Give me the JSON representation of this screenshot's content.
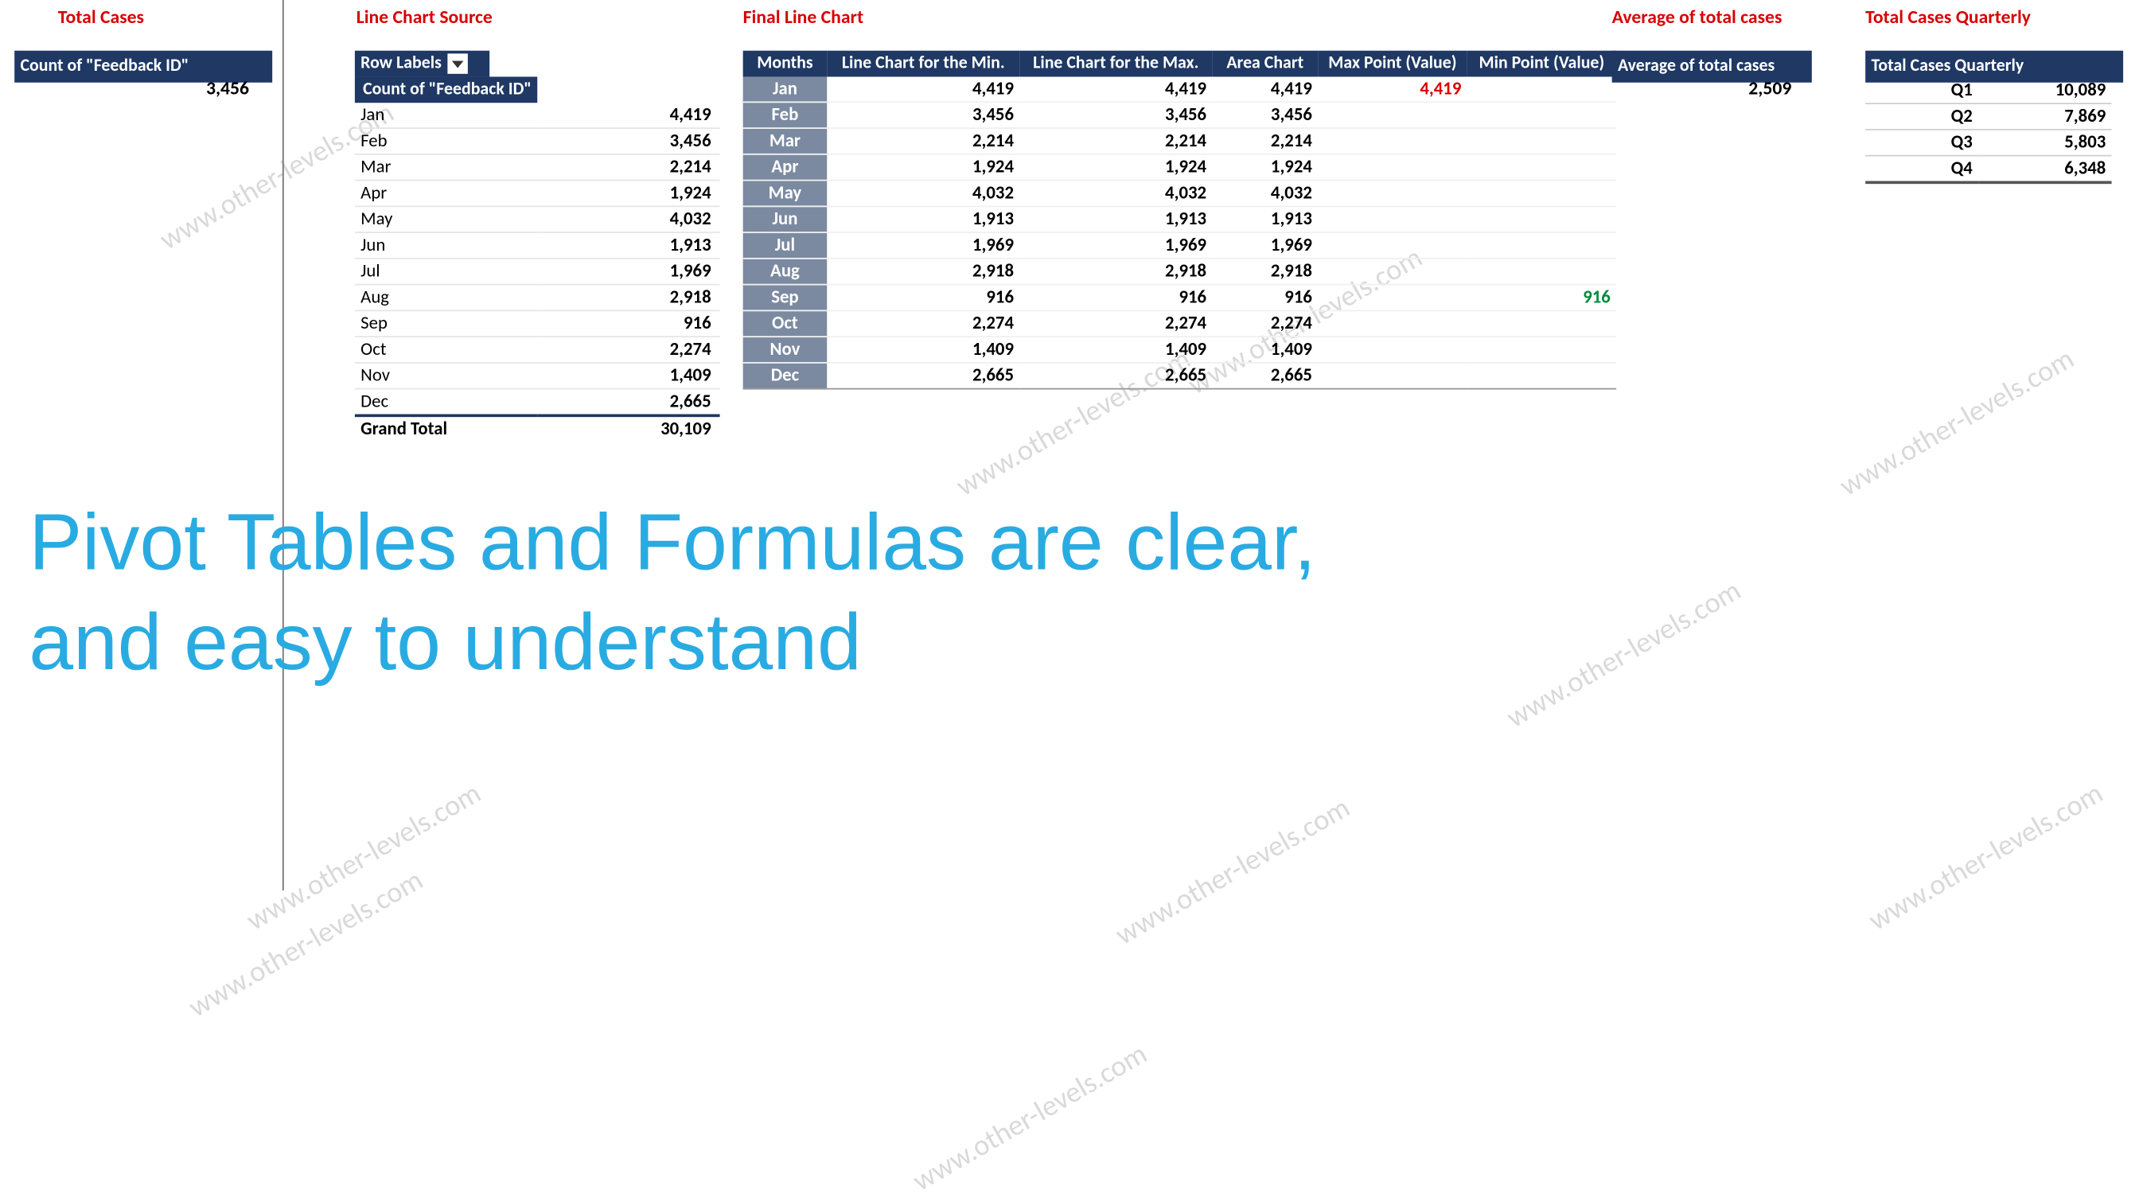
{
  "sections": {
    "total_cases": "Total Cases",
    "line_src": "Line Chart Source",
    "final": "Final Line Chart",
    "avg": "Average of total cases",
    "quarterly": "Total Cases Quarterly"
  },
  "total_cases": {
    "header": "Count of \"Feedback ID\"",
    "value": "3,456"
  },
  "source": {
    "head_rows": "Row Labels",
    "head_cnt": "Count of \"Feedback ID\"",
    "rows": [
      {
        "m": "Jan",
        "v": "4,419"
      },
      {
        "m": "Feb",
        "v": "3,456"
      },
      {
        "m": "Mar",
        "v": "2,214"
      },
      {
        "m": "Apr",
        "v": "1,924"
      },
      {
        "m": "May",
        "v": "4,032"
      },
      {
        "m": "Jun",
        "v": "1,913"
      },
      {
        "m": "Jul",
        "v": "1,969"
      },
      {
        "m": "Aug",
        "v": "2,918"
      },
      {
        "m": "Sep",
        "v": "916"
      },
      {
        "m": "Oct",
        "v": "2,274"
      },
      {
        "m": "Nov",
        "v": "1,409"
      },
      {
        "m": "Dec",
        "v": "2,665"
      }
    ],
    "grand_label": "Grand Total",
    "grand_val": "30,109"
  },
  "final": {
    "heads": [
      "Months",
      "Line Chart for the Min.",
      "Line Chart for the Max.",
      "Area Chart",
      "Max Point (Value)",
      "Min Point (Value)"
    ],
    "rows": [
      {
        "m": "Jan",
        "a": "4,419",
        "b": "4,419",
        "c": "4,419",
        "max": "4,419",
        "min": ""
      },
      {
        "m": "Feb",
        "a": "3,456",
        "b": "3,456",
        "c": "3,456",
        "max": "",
        "min": ""
      },
      {
        "m": "Mar",
        "a": "2,214",
        "b": "2,214",
        "c": "2,214",
        "max": "",
        "min": ""
      },
      {
        "m": "Apr",
        "a": "1,924",
        "b": "1,924",
        "c": "1,924",
        "max": "",
        "min": ""
      },
      {
        "m": "May",
        "a": "4,032",
        "b": "4,032",
        "c": "4,032",
        "max": "",
        "min": ""
      },
      {
        "m": "Jun",
        "a": "1,913",
        "b": "1,913",
        "c": "1,913",
        "max": "",
        "min": ""
      },
      {
        "m": "Jul",
        "a": "1,969",
        "b": "1,969",
        "c": "1,969",
        "max": "",
        "min": ""
      },
      {
        "m": "Aug",
        "a": "2,918",
        "b": "2,918",
        "c": "2,918",
        "max": "",
        "min": ""
      },
      {
        "m": "Sep",
        "a": "916",
        "b": "916",
        "c": "916",
        "max": "",
        "min": "916"
      },
      {
        "m": "Oct",
        "a": "2,274",
        "b": "2,274",
        "c": "2,274",
        "max": "",
        "min": ""
      },
      {
        "m": "Nov",
        "a": "1,409",
        "b": "1,409",
        "c": "1,409",
        "max": "",
        "min": ""
      },
      {
        "m": "Dec",
        "a": "2,665",
        "b": "2,665",
        "c": "2,665",
        "max": "",
        "min": ""
      }
    ]
  },
  "avg": {
    "header": "Average of total cases",
    "value": "2,509"
  },
  "quarterly": {
    "header": "Total Cases Quarterly",
    "rows": [
      {
        "q": "Q1",
        "v": "10,089"
      },
      {
        "q": "Q2",
        "v": "7,869"
      },
      {
        "q": "Q3",
        "v": "5,803"
      },
      {
        "q": "Q4",
        "v": "6,348"
      }
    ]
  },
  "watermark": "www.other-levels.com",
  "overlay_line1": "Pivot Tables and Formulas are clear,",
  "overlay_line2": "and easy to understand",
  "chart_data": {
    "type": "table",
    "title": "Monthly Count of Feedback ID",
    "categories": [
      "Jan",
      "Feb",
      "Mar",
      "Apr",
      "May",
      "Jun",
      "Jul",
      "Aug",
      "Sep",
      "Oct",
      "Nov",
      "Dec"
    ],
    "values": [
      4419,
      3456,
      2214,
      1924,
      4032,
      1913,
      1969,
      2918,
      916,
      2274,
      1409,
      2665
    ],
    "grand_total": 30109,
    "average": 2509,
    "max": {
      "month": "Jan",
      "value": 4419
    },
    "min": {
      "month": "Sep",
      "value": 916
    },
    "quarterly": {
      "Q1": 10089,
      "Q2": 7869,
      "Q3": 5803,
      "Q4": 6348
    }
  }
}
